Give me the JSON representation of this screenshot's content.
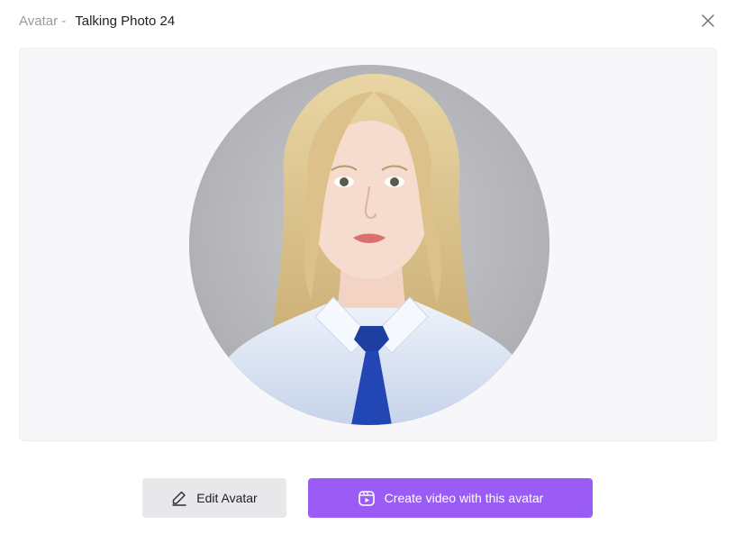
{
  "header": {
    "prefix": "Avatar -",
    "name": "Talking Photo 24"
  },
  "icons": {
    "close": "close-icon",
    "edit": "pencil-icon",
    "create": "video-icon"
  },
  "actions": {
    "edit_label": "Edit Avatar",
    "create_label": "Create video with this avatar"
  },
  "colors": {
    "accent": "#9b5cf6",
    "secondary_button": "#e8e8eb",
    "preview_bg": "#f7f7f9"
  }
}
